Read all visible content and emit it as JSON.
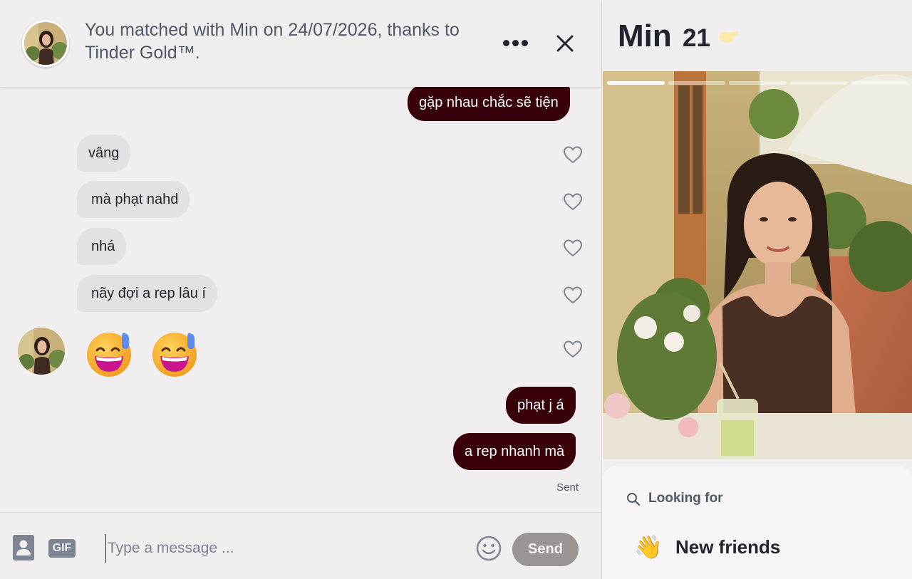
{
  "header": {
    "match_text": "You matched with Min on 24/07/2026, thanks to Tinder Gold™.",
    "more_icon": "more-horizontal-icon",
    "close_icon": "close-icon"
  },
  "messages": [
    {
      "direction": "outgoing",
      "text": "gặp nhau chắc sẽ tiện"
    },
    {
      "direction": "incoming",
      "text": "vâng"
    },
    {
      "direction": "incoming",
      "text": "mà phạt nahd"
    },
    {
      "direction": "incoming",
      "text": "nhá"
    },
    {
      "direction": "incoming",
      "text": "nãy đợi a rep lâu í"
    },
    {
      "direction": "incoming",
      "emoji": "grinning-sweat-emoji",
      "count": 2
    },
    {
      "direction": "outgoing",
      "text": "phạt j á"
    },
    {
      "direction": "outgoing",
      "text": "a rep nhanh mà"
    }
  ],
  "status": {
    "sent": "Sent"
  },
  "composer": {
    "gif_label": "GIF",
    "placeholder": "Type a message ...",
    "send_label": "Send"
  },
  "profile": {
    "name": "Min",
    "age": "21",
    "photo_count": 5,
    "photo_index": 1,
    "looking_for_label": "Looking for",
    "looking_for_value": "New friends",
    "looking_for_emoji": "👋"
  },
  "colors": {
    "outgoing_bubble": "#380009",
    "incoming_bubble": "#e3e1e2",
    "background": "#f0eeef",
    "send_button": "#9a9493"
  }
}
